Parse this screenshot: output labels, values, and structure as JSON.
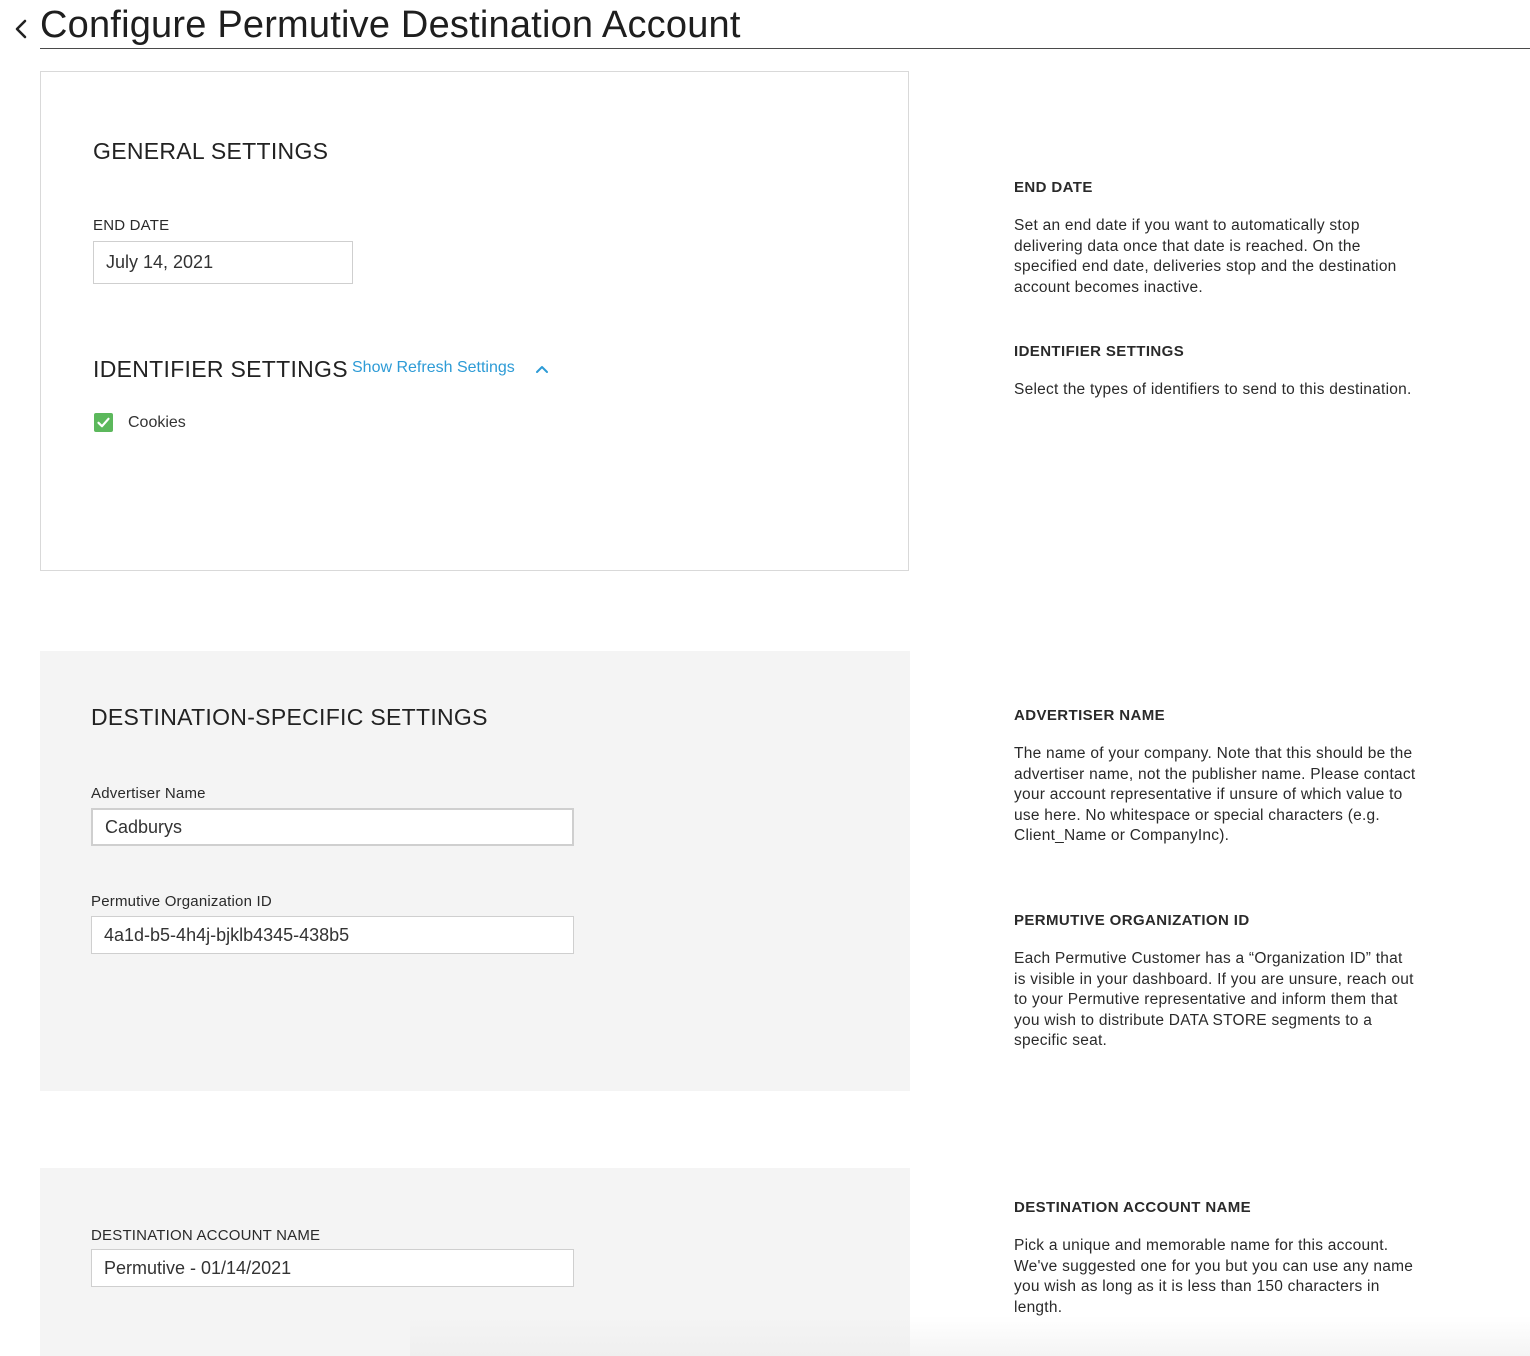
{
  "header": {
    "title": "Configure Permutive Destination Account"
  },
  "general_settings": {
    "title": "GENERAL SETTINGS",
    "end_date": {
      "label": "END DATE",
      "value": "July 14, 2021"
    },
    "identifier_settings": {
      "title": "IDENTIFIER SETTINGS",
      "refresh_link": "Show Refresh Settings",
      "cookies": {
        "label": "Cookies",
        "checked": true
      }
    }
  },
  "destination_settings": {
    "title": "DESTINATION-SPECIFIC SETTINGS",
    "advertiser_name": {
      "label": "Advertiser Name",
      "value": "Cadburys"
    },
    "organization_id": {
      "label": "Permutive Organization ID",
      "value": "4a1d-b5-4h4j-bjklb4345-438b5"
    }
  },
  "account_settings": {
    "account_name": {
      "label": "DESTINATION ACCOUNT NAME",
      "value": "Permutive - 01/14/2021"
    }
  },
  "help": {
    "end_date": {
      "title": "END DATE",
      "text": "Set an end date if you want to automatically stop delivering data once that date is reached. On the specified end date, deliveries stop and the destination account becomes inactive."
    },
    "identifier_settings": {
      "title": "IDENTIFIER SETTINGS",
      "text": "Select the types of identifiers to send to this destination."
    },
    "advertiser_name": {
      "title": "ADVERTISER NAME",
      "text": "The name of your company. Note that this should be the advertiser name, not the publisher name. Please contact your account representative if unsure of which value to use here. No whitespace or special characters (e.g. Client_Name or CompanyInc)."
    },
    "organization_id": {
      "title": "PERMUTIVE ORGANIZATION ID",
      "text": "Each Permutive Customer has a “Organization ID” that is visible in your dashboard. If you are unsure, reach out to your Permutive representative and inform them that you wish to distribute DATA STORE segments to a specific seat."
    },
    "account_name": {
      "title": "DESTINATION ACCOUNT NAME",
      "text": "Pick a unique and memorable name for this account. We've suggested one for you but you can use any name you wish as long as it is less than 150 characters in length."
    }
  },
  "colors": {
    "link": "#2d9bd6",
    "checkbox": "#5cb85c",
    "panel_gray": "#f4f4f4"
  }
}
